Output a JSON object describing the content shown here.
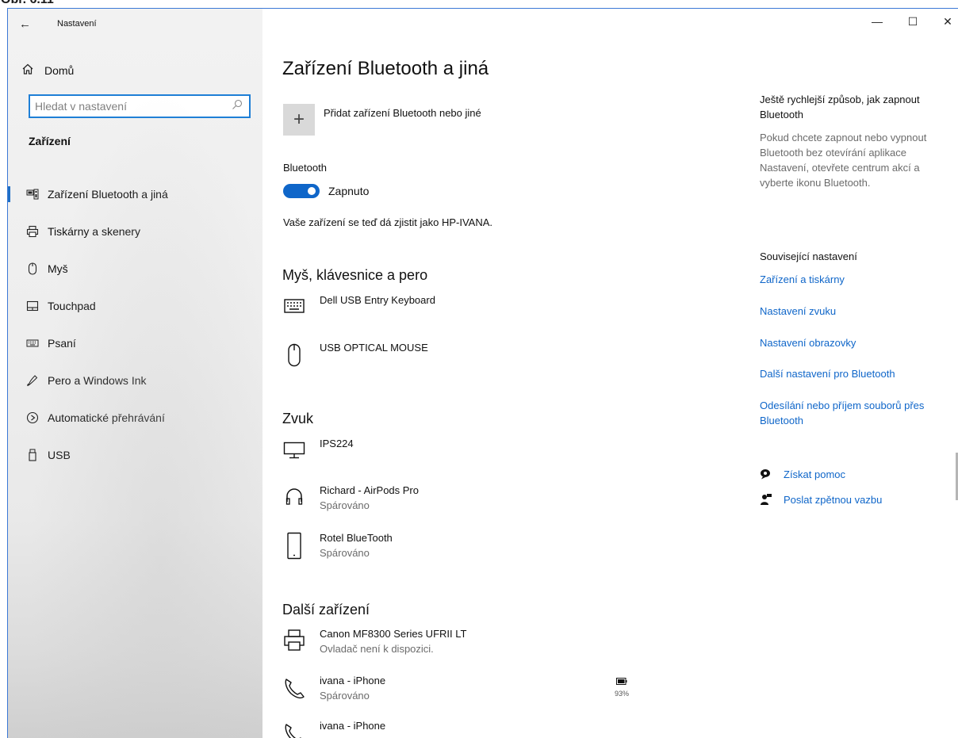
{
  "caption": "Obr. 6.11",
  "window": {
    "back_glyph": "←",
    "app_title": "Nastavení",
    "minimize_glyph": "—",
    "maximize_glyph": "☐",
    "close_glyph": "✕"
  },
  "sidebar": {
    "home_label": "Domů",
    "search_placeholder": "Hledat v nastavení",
    "section_label": "Zařízení",
    "items": [
      {
        "label": "Zařízení Bluetooth a jiná",
        "icon": "bluetooth-devices-icon",
        "active": true
      },
      {
        "label": "Tiskárny a skenery",
        "icon": "printer-icon"
      },
      {
        "label": "Myš",
        "icon": "mouse-icon"
      },
      {
        "label": "Touchpad",
        "icon": "touchpad-icon"
      },
      {
        "label": "Psaní",
        "icon": "keyboard-icon"
      },
      {
        "label": "Pero a Windows Ink",
        "icon": "pen-icon"
      },
      {
        "label": "Automatické přehrávání",
        "icon": "autoplay-icon"
      },
      {
        "label": "USB",
        "icon": "usb-icon"
      }
    ]
  },
  "main": {
    "title": "Zařízení Bluetooth a jiná",
    "add_label": "Přidat zařízení Bluetooth nebo jiné",
    "bluetooth_label": "Bluetooth",
    "toggle_state": "Zapnuto",
    "discoverable_text": "Vaše zařízení se teď dá zjistit jako HP-IVANA.",
    "groups": {
      "mouse": {
        "heading": "Myš, klávesnice a pero",
        "devices": [
          {
            "name": "Dell USB Entry Keyboard",
            "status": "",
            "icon": "keyboard-icon"
          },
          {
            "name": "USB OPTICAL MOUSE",
            "status": "",
            "icon": "mouse-icon"
          }
        ]
      },
      "audio": {
        "heading": "Zvuk",
        "devices": [
          {
            "name": "IPS224",
            "status": "",
            "icon": "monitor-icon"
          },
          {
            "name": "Richard - AirPods Pro",
            "status": "Spárováno",
            "icon": "headphones-icon"
          },
          {
            "name": "Rotel BlueTooth",
            "status": "Spárováno",
            "icon": "phone-icon"
          }
        ]
      },
      "other": {
        "heading": "Další zařízení",
        "devices": [
          {
            "name": "Canon MF8300 Series UFRII LT",
            "status": "Ovladač není k dispozici.",
            "icon": "printer-icon"
          },
          {
            "name": "ivana - iPhone",
            "status": "Spárováno",
            "icon": "phone-handset-icon",
            "battery": "93%"
          },
          {
            "name": "ivana - iPhone",
            "status": "",
            "icon": "phone-handset-icon"
          }
        ]
      }
    }
  },
  "right": {
    "tip_heading": "Ještě rychlejší způsob, jak zapnout Bluetooth",
    "tip_text": "Pokud chcete zapnout nebo vypnout Bluetooth bez otevírání aplikace Nastavení, otevřete centrum akcí a vyberte ikonu Bluetooth.",
    "related_heading": "Související nastavení",
    "links": [
      "Zařízení a tiskárny",
      "Nastavení zvuku",
      "Nastavení obrazovky",
      "Další nastavení pro Bluetooth",
      "Odesílání nebo příjem souborů přes Bluetooth"
    ],
    "help_label": "Získat pomoc",
    "feedback_label": "Poslat zpětnou vazbu"
  },
  "colors": {
    "accent": "#0f66c9",
    "search_border": "#1e7fd6",
    "window_border": "#3b78d6"
  }
}
